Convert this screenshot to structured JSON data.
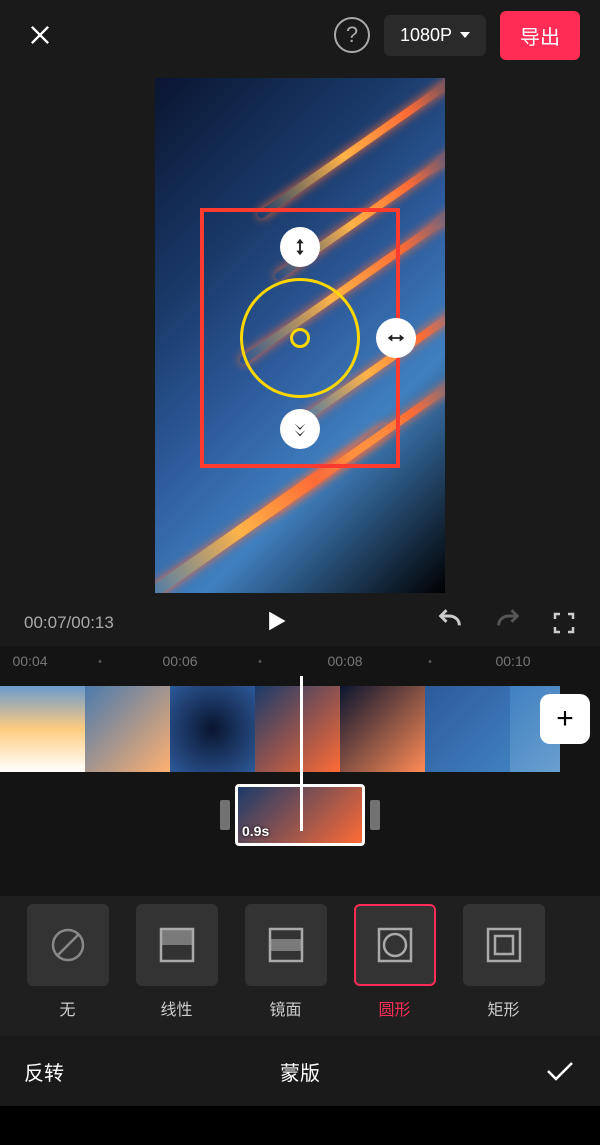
{
  "header": {
    "resolution": "1080P",
    "export_label": "导出"
  },
  "player": {
    "current_time": "00:07",
    "total_time": "00:13"
  },
  "timeline": {
    "ruler_marks": [
      "00:04",
      "00:06",
      "00:08",
      "00:10"
    ],
    "sub_clip_duration": "0.9s"
  },
  "mask_options": [
    {
      "id": "none",
      "label": "无",
      "selected": false
    },
    {
      "id": "linear",
      "label": "线性",
      "selected": false
    },
    {
      "id": "mirror",
      "label": "镜面",
      "selected": false
    },
    {
      "id": "circle",
      "label": "圆形",
      "selected": true
    },
    {
      "id": "rect",
      "label": "矩形",
      "selected": false
    }
  ],
  "bottom": {
    "invert_label": "反转",
    "panel_title": "蒙版"
  }
}
